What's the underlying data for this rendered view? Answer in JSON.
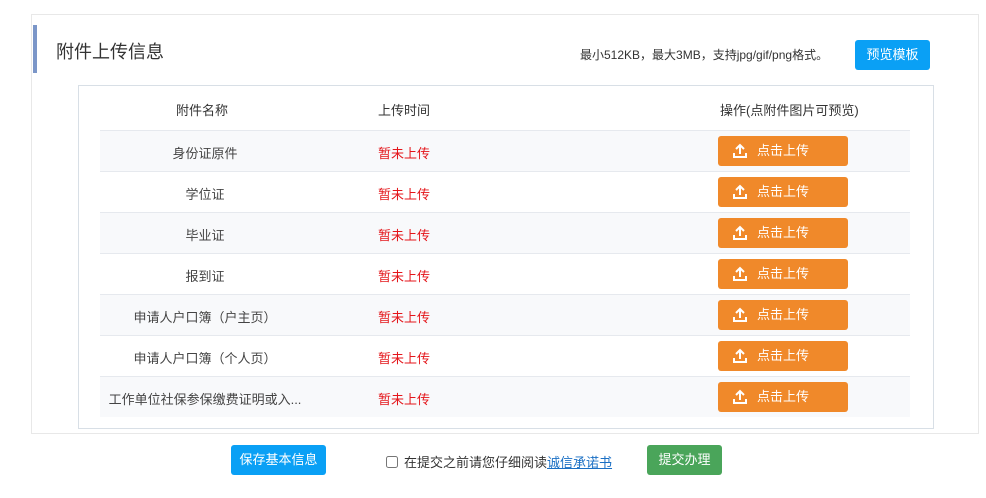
{
  "header": {
    "title": "附件上传信息",
    "hint": "最小512KB，最大3MB，支持jpg/gif/png格式。",
    "preview_label": "预览模板"
  },
  "table": {
    "headers": [
      "附件名称",
      "上传时间",
      "操作(点附件图片可预览)"
    ],
    "rows": [
      {
        "name": "身份证原件",
        "status": "暂未上传",
        "action": "点击上传"
      },
      {
        "name": "学位证",
        "status": "暂未上传",
        "action": "点击上传"
      },
      {
        "name": "毕业证",
        "status": "暂未上传",
        "action": "点击上传"
      },
      {
        "name": "报到证",
        "status": "暂未上传",
        "action": "点击上传"
      },
      {
        "name": "申请人户口簿（户主页）",
        "status": "暂未上传",
        "action": "点击上传"
      },
      {
        "name": "申请人户口簿（个人页）",
        "status": "暂未上传",
        "action": "点击上传"
      },
      {
        "name": "工作单位社保参保缴费证明或入...",
        "status": "暂未上传",
        "action": "点击上传"
      }
    ]
  },
  "footer": {
    "save_label": "保存基本信息",
    "agree_text": "在提交之前请您仔细阅读",
    "agree_link": "诚信承诺书",
    "submit_label": "提交办理"
  }
}
